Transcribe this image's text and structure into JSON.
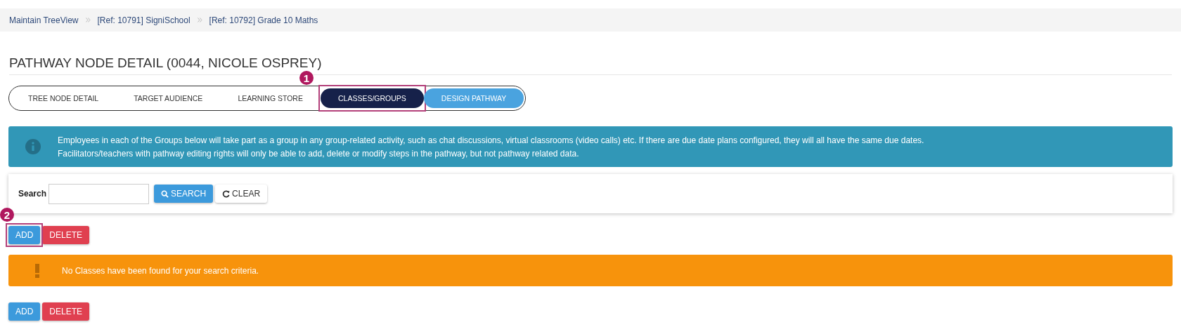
{
  "breadcrumb": [
    "Maintain TreeView",
    "[Ref: 10791] SigniSchool",
    "[Ref: 10792] Grade 10 Maths"
  ],
  "title": "PATHWAY NODE DETAIL (0044, NICOLE OSPREY)",
  "tabs": [
    {
      "label": "TREE NODE DETAIL",
      "selected": false,
      "kind": "plain"
    },
    {
      "label": "TARGET AUDIENCE",
      "selected": false,
      "kind": "plain"
    },
    {
      "label": "LEARNING STORE",
      "selected": false,
      "kind": "plain"
    },
    {
      "label": "CLASSES/GROUPS",
      "selected": true,
      "kind": "plain",
      "callout": "1"
    },
    {
      "label": "DESIGN PATHWAY",
      "selected": false,
      "kind": "accent"
    }
  ],
  "info": {
    "lines": [
      "Employees in each of the Groups below will take part as a group in any group-related activity, such as chat discussions, virtual classrooms (video calls) etc. If there are due date plans configured, they will all have the same due dates.",
      "Facilitators/teachers with pathway editing rights will only be able to add, delete or modify steps in the pathway, but not pathway related data."
    ]
  },
  "search": {
    "label": "Search",
    "search_button": "SEARCH",
    "clear_button": "CLEAR"
  },
  "top_actions": {
    "add": "ADD",
    "delete": "DELETE",
    "callout": "2"
  },
  "warning": "No Classes have been found for your search criteria.",
  "bottom_actions": {
    "add": "ADD",
    "delete": "DELETE"
  }
}
